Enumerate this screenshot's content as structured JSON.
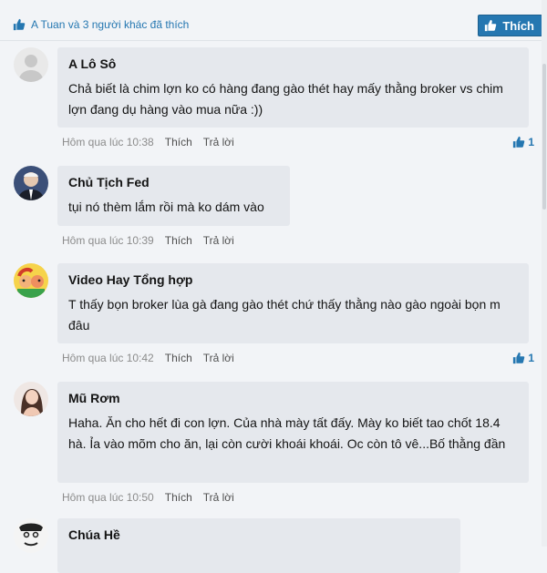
{
  "header": {
    "likes_summary": "A Tuan và 3 người khác đã thích",
    "like_button_label": "Thích"
  },
  "colors": {
    "accent": "#2577b1",
    "bubble": "#e5e8ed",
    "background": "#f2f4f7"
  },
  "comments": [
    {
      "author": "A Lô Sô",
      "text": "Chả biết là chim lợn ko có hàng đang gào thét hay mấy thằng broker vs chim lợn đang dụ hàng vào mua nữa :))",
      "time": "Hôm qua lúc 10:38",
      "like_label": "Thích",
      "reply_label": "Trả lời",
      "likes": "1",
      "avatar_icon": "default-user-avatar"
    },
    {
      "author": "Chủ Tịch Fed",
      "text": "tụi nó thèm lắm rồi mà ko dám vào",
      "time": "Hôm qua lúc 10:39",
      "like_label": "Thích",
      "reply_label": "Trả lời",
      "avatar_icon": "man-in-suit-avatar"
    },
    {
      "author": "Video Hay Tổng hợp",
      "text": "T thấy bọn broker lùa gà đang gào thét chứ thấy thằng nào gào ngoài bọn m đâu",
      "time": "Hôm qua lúc 10:42",
      "like_label": "Thích",
      "reply_label": "Trả lời",
      "likes": "1",
      "avatar_icon": "cartoon-avatar"
    },
    {
      "author": "Mũ Rơm",
      "text": "Haha. Ăn cho hết đi con lợn. Của nhà mày tất đấy. Mày ko biết tao chốt 18.4 hà. Ỉa vào mõm cho ăn, lại còn cười khoái khoái. Oc còn tô vê...Bố thằng đần",
      "time": "Hôm qua lúc 10:50",
      "like_label": "Thích",
      "reply_label": "Trả lời",
      "avatar_icon": "woman-avatar"
    },
    {
      "author": "Chúa Hề",
      "avatar_icon": "sketch-face-avatar"
    }
  ]
}
